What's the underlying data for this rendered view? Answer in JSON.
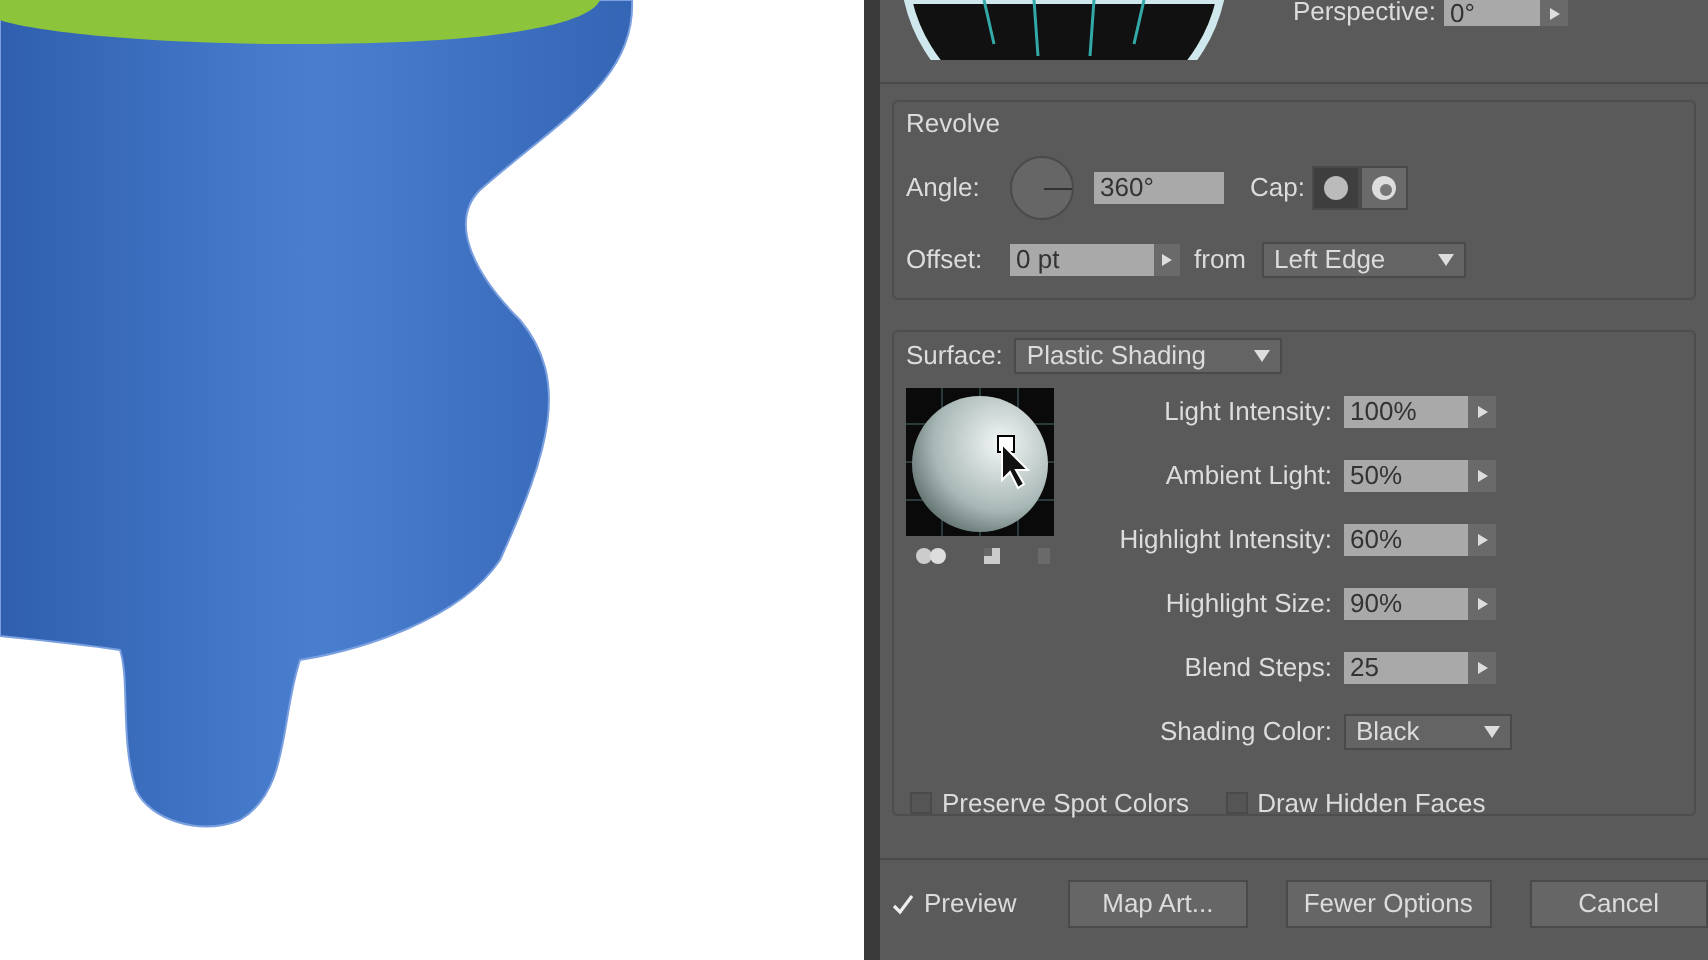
{
  "perspective": {
    "label": "Perspective:",
    "value": "0°"
  },
  "revolve": {
    "title": "Revolve",
    "angle_label": "Angle:",
    "angle_value": "360°",
    "cap_label": "Cap:",
    "caps": [
      {
        "selected": true
      },
      {
        "selected": false
      }
    ],
    "offset_label": "Offset:",
    "offset_value": "0 pt",
    "from_label": "from",
    "from_value": "Left Edge"
  },
  "surface": {
    "label": "Surface:",
    "value": "Plastic Shading",
    "properties": [
      {
        "label": "Light Intensity:",
        "value": "100%",
        "kind": "stepper"
      },
      {
        "label": "Ambient Light:",
        "value": "50%",
        "kind": "stepper"
      },
      {
        "label": "Highlight Intensity:",
        "value": "60%",
        "kind": "stepper"
      },
      {
        "label": "Highlight Size:",
        "value": "90%",
        "kind": "stepper"
      },
      {
        "label": "Blend Steps:",
        "value": "25",
        "kind": "stepper"
      },
      {
        "label": "Shading Color:",
        "value": "Black",
        "kind": "dropdown"
      }
    ],
    "options": [
      {
        "label": "Preserve Spot Colors",
        "checked": false
      },
      {
        "label": "Draw Hidden Faces",
        "checked": false
      }
    ]
  },
  "footer": {
    "preview": {
      "label": "Preview",
      "checked": true
    },
    "buttons": [
      "Map Art...",
      "Fewer Options",
      "Cancel"
    ]
  }
}
